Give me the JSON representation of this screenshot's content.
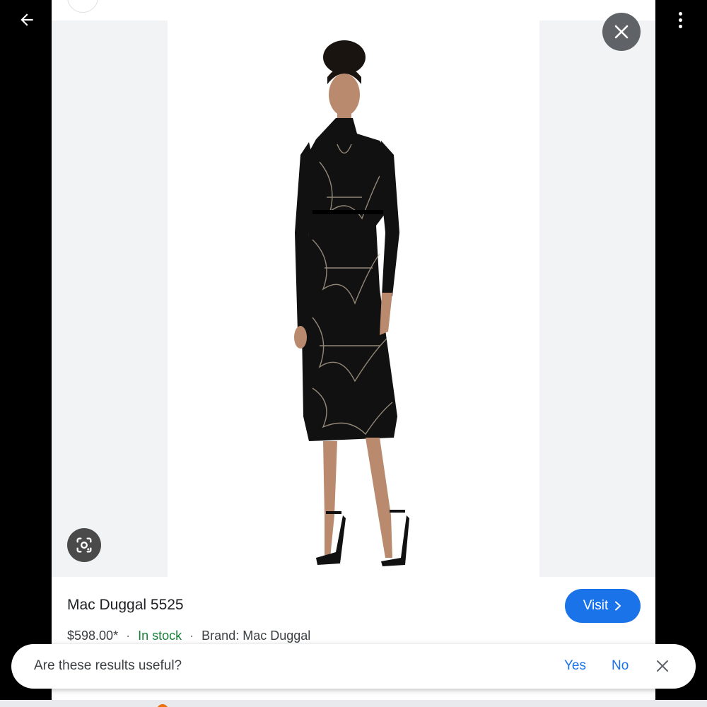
{
  "product": {
    "title": "Mac Duggal 5525",
    "price": "$598.00*",
    "availability": "In stock",
    "brand": "Brand: Mac Duggal",
    "separator": "·",
    "visit_label": "Visit"
  },
  "feedback": {
    "question": "Are these results useful?",
    "yes_label": "Yes",
    "no_label": "No"
  },
  "icons": {
    "back": "arrow-left-icon",
    "close": "close-icon",
    "more": "more-vert-icon",
    "lens": "lens-icon",
    "visit_chevron": "chevron-right-icon",
    "feedback_close": "close-icon"
  },
  "colors": {
    "accent": "#1a73e8",
    "in_stock": "#188038",
    "close_bg": "#5f6368"
  }
}
